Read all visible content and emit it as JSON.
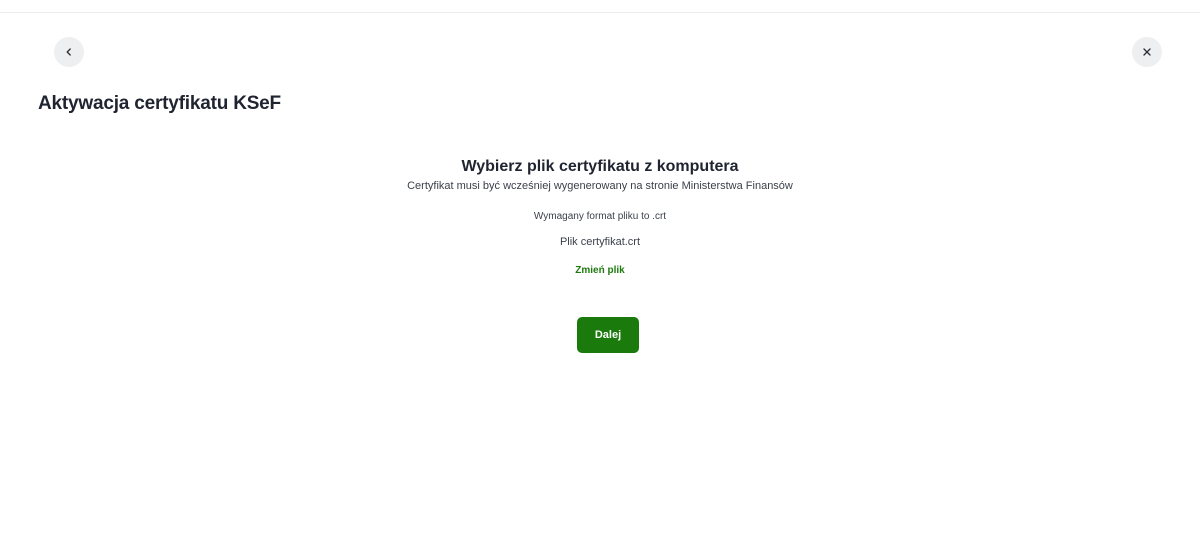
{
  "header": {
    "back_icon": "chevron-left-icon",
    "close_icon": "close-icon",
    "title": "Aktywacja certyfikatu KSeF"
  },
  "main": {
    "heading": "Wybierz plik certyfikatu z komputera",
    "description": "Certyfikat musi być wcześniej wygenerowany na stronie Ministerstwa Finansów",
    "format_note": "Wymagany format pliku to .crt",
    "file_name": "Plik certyfikat.crt",
    "change_file_label": "Zmień plik",
    "next_button_label": "Dalej"
  },
  "colors": {
    "accent": "#1a7a0c",
    "link": "#1f7a10",
    "round_button_bg": "#eeeff1"
  }
}
